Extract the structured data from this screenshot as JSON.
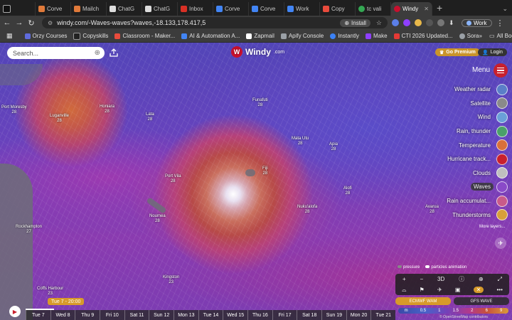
{
  "browser": {
    "tabs": [
      {
        "label": "",
        "icon": "upwork-icon",
        "color": "#111111"
      },
      {
        "label": "Corve",
        "icon": "doc-icon",
        "color": "#e07a3a"
      },
      {
        "label": "Mailch",
        "icon": "mailchimp-icon",
        "color": "#e07a3a"
      },
      {
        "label": "ChatG",
        "icon": "chatgpt-icon",
        "color": "#dddddd"
      },
      {
        "label": "ChatG",
        "icon": "chatgpt-icon",
        "color": "#dddddd"
      },
      {
        "label": "Inbox",
        "icon": "gmail-icon",
        "color": "#d93025"
      },
      {
        "label": "Corve",
        "icon": "docs-icon",
        "color": "#4285f4"
      },
      {
        "label": "Corve",
        "icon": "docs-icon",
        "color": "#4285f4"
      },
      {
        "label": "Work",
        "icon": "docs-icon",
        "color": "#4285f4"
      },
      {
        "label": "Copy",
        "icon": "copy-icon",
        "color": "#e94b3c"
      },
      {
        "label": "tc vali",
        "icon": "google-icon",
        "color": "#34a853"
      },
      {
        "label": "Windy",
        "icon": "windy-icon",
        "color": "#c8102e",
        "active": true
      }
    ],
    "url": "windy.com/-Waves-waves?waves,-18.133,178.417,5",
    "install_label": "Install",
    "profile_label": "Work",
    "bookmarks": [
      {
        "label": "Orzy Courses",
        "color": "#5f6bdc"
      },
      {
        "label": "Copyskills",
        "color": "#222222"
      },
      {
        "label": "Classroom - Maker...",
        "color": "#e94b3c"
      },
      {
        "label": "AI & Automation A...",
        "color": "#4285f4"
      },
      {
        "label": "Zapmail",
        "color": "#ffffff"
      },
      {
        "label": "Apify Console",
        "color": "#9aa0a6"
      },
      {
        "label": "Instantly",
        "color": "#3b82f6"
      },
      {
        "label": "Make",
        "color": "#8f3fff"
      },
      {
        "label": "CTI 2026 Updated...",
        "color": "#e53935"
      },
      {
        "label": "Sora",
        "color": "#9aa0a6"
      }
    ],
    "all_bookmarks_label": "All Bookmarks"
  },
  "windy": {
    "search_placeholder": "Search...",
    "logo_text": "Windy",
    "logo_suffix": ".com",
    "premium_label": "Go Premium",
    "login_label": "Login",
    "menu_label": "Menu",
    "layers": [
      {
        "name": "Weather radar",
        "color": "#5b7fc8"
      },
      {
        "name": "Satellite",
        "color": "#8a8a8a"
      },
      {
        "name": "Wind",
        "color": "#6aa0d8"
      },
      {
        "name": "Rain, thunder",
        "color": "#4aa06a"
      },
      {
        "name": "Temperature",
        "color": "#d8703a"
      },
      {
        "name": "Hurricane track...",
        "color": "#c8202e"
      },
      {
        "name": "Clouds",
        "color": "#bfbfbf"
      },
      {
        "name": "Waves",
        "color": "#8a4ac8",
        "active": true
      },
      {
        "name": "Rain accumulat...",
        "color": "#c85a8a"
      },
      {
        "name": "Thunderstorms",
        "color": "#d8a03a"
      }
    ],
    "more_layers_label": "More layers...",
    "pressure_label": "pressure",
    "animation_label": "particles animation",
    "zoom_in": "+",
    "zoom_out": "−",
    "view_3d": "3D",
    "models": {
      "selected": "ECMWF WAM",
      "other": "GFS WAVE"
    },
    "scale": {
      "unit": "m",
      "ticks": [
        "0.5",
        "1",
        "1.5",
        "2",
        "6",
        "9"
      ]
    },
    "attribution": "© OpenStreetMap contributors",
    "current_time": "Tue 7 - 20:00",
    "days": [
      "Tue 7",
      "Wed 8",
      "Thu 9",
      "Fri 10",
      "Sat 11",
      "Sun 12",
      "Mon 13",
      "Tue 14",
      "Wed 15",
      "Thu 16",
      "Fri 17",
      "Sat 18",
      "Sun 19",
      "Mon 20",
      "Tue 21"
    ],
    "places": [
      {
        "name": "Port Vila",
        "temp": "28"
      },
      {
        "name": "Fiji",
        "temp": "28"
      },
      {
        "name": "Nuku'alofa",
        "temp": "28"
      },
      {
        "name": "Noumea",
        "temp": "28"
      },
      {
        "name": "Avarua",
        "temp": "28"
      },
      {
        "name": "Apia",
        "temp": "28"
      },
      {
        "name": "Funafuti",
        "temp": "28"
      },
      {
        "name": "Mata Utu",
        "temp": "28"
      },
      {
        "name": "Alofi",
        "temp": "28"
      },
      {
        "name": "Honiara",
        "temp": "28"
      },
      {
        "name": "Rockhampton",
        "temp": "27"
      },
      {
        "name": "Coffs Harbour",
        "temp": "23"
      },
      {
        "name": "Kingston",
        "temp": "23"
      },
      {
        "name": "Luganville",
        "temp": "28"
      },
      {
        "name": "Lata",
        "temp": "28"
      },
      {
        "name": "Port Moresby",
        "temp": "28"
      }
    ]
  }
}
